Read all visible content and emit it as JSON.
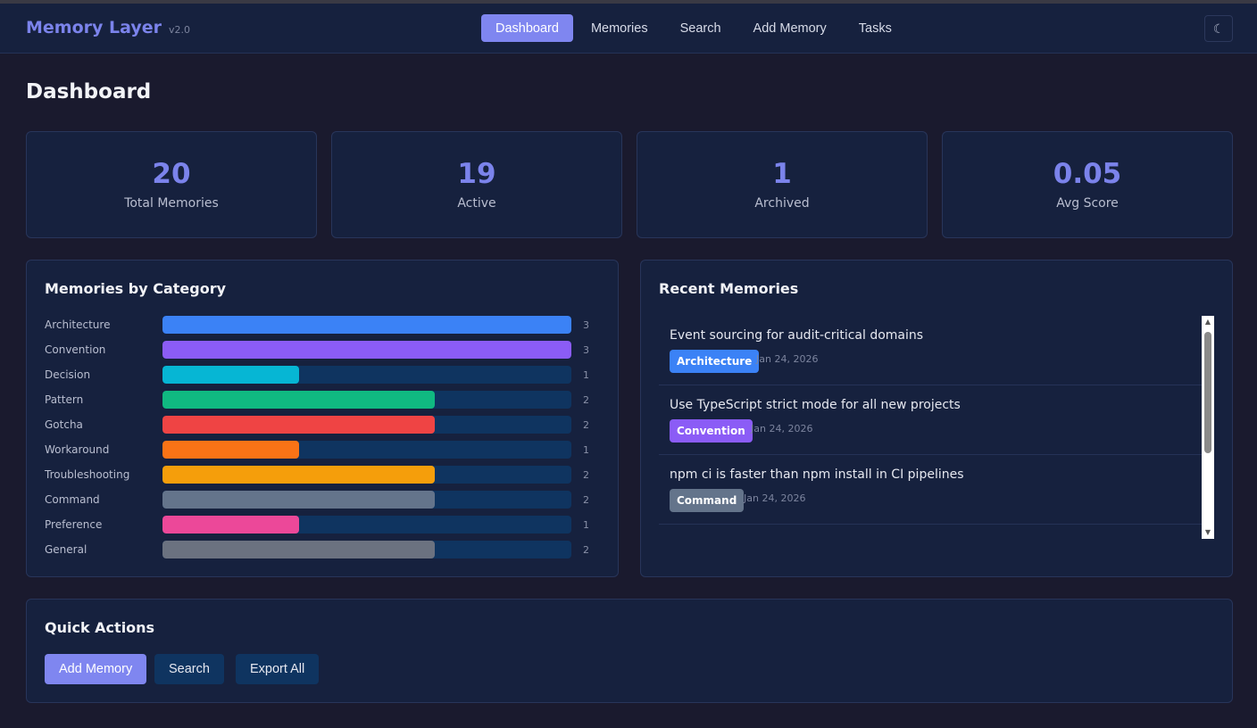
{
  "app": {
    "name": "Memory Layer",
    "version": "v2.0"
  },
  "nav": {
    "items": [
      {
        "label": "Dashboard",
        "active": true
      },
      {
        "label": "Memories",
        "active": false
      },
      {
        "label": "Search",
        "active": false
      },
      {
        "label": "Add Memory",
        "active": false
      },
      {
        "label": "Tasks",
        "active": false
      }
    ],
    "theme_toggle": "☾"
  },
  "page": {
    "title": "Dashboard"
  },
  "stats": [
    {
      "value": "20",
      "label": "Total Memories"
    },
    {
      "value": "19",
      "label": "Active"
    },
    {
      "value": "1",
      "label": "Archived"
    },
    {
      "value": "0.05",
      "label": "Avg Score"
    }
  ],
  "categories": {
    "title": "Memories by Category",
    "max": 3,
    "items": [
      {
        "label": "Architecture",
        "count": 3,
        "color": "#3b82f6"
      },
      {
        "label": "Convention",
        "count": 3,
        "color": "#8b5cf6"
      },
      {
        "label": "Decision",
        "count": 1,
        "color": "#06b6d4"
      },
      {
        "label": "Pattern",
        "count": 2,
        "color": "#10b981"
      },
      {
        "label": "Gotcha",
        "count": 2,
        "color": "#ef4444"
      },
      {
        "label": "Workaround",
        "count": 1,
        "color": "#f97316"
      },
      {
        "label": "Troubleshooting",
        "count": 2,
        "color": "#f59e0b"
      },
      {
        "label": "Command",
        "count": 2,
        "color": "#64748b"
      },
      {
        "label": "Preference",
        "count": 1,
        "color": "#ec4899"
      },
      {
        "label": "General",
        "count": 2,
        "color": "#6b7280"
      }
    ]
  },
  "recent": {
    "title": "Recent Memories",
    "items": [
      {
        "title": "Event sourcing for audit-critical domains",
        "category": "Architecture",
        "color": "#3b82f6",
        "date": "Jan 24, 2026"
      },
      {
        "title": "Use TypeScript strict mode for all new projects",
        "category": "Convention",
        "color": "#8b5cf6",
        "date": "Jan 24, 2026"
      },
      {
        "title": "npm ci is faster than npm install in CI pipelines",
        "category": "Command",
        "color": "#64748b",
        "date": "Jan 24, 2026"
      }
    ],
    "scroll_up": "▲",
    "scroll_down": "▼"
  },
  "quick_actions": {
    "title": "Quick Actions",
    "add": "Add Memory",
    "search": "Search",
    "export": "Export All"
  }
}
